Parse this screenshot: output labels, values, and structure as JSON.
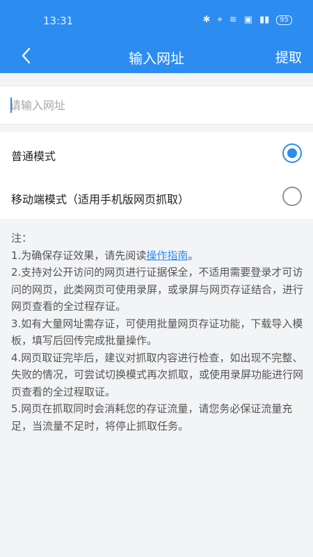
{
  "status_bar": {
    "time": "13:31",
    "icons": [
      "bluetooth-icon",
      "location-icon",
      "wifi-icon",
      "hd-icon",
      "signal-icon"
    ],
    "battery": "95"
  },
  "header": {
    "title": "输入网址",
    "action_label": "提取"
  },
  "url_input": {
    "placeholder": "请输入网址",
    "value": ""
  },
  "modes": [
    {
      "label": "普通模式",
      "selected": true
    },
    {
      "label": "移动端模式（适用手机版网页抓取）",
      "selected": false
    }
  ],
  "notes": {
    "heading": "注：",
    "item1_prefix": "1.为确保存证效果，请先阅读",
    "item1_link": "操作指南",
    "item1_suffix": "。",
    "item2": "2.支持对公开访问的网页进行证据保全，不适用需要登录才可访问的网页，此类网页可使用录屏，或录屏与网页存证结合，进行网页查看的全过程存证。",
    "item3": "3.如有大量网址需存证，可使用批量网页存证功能，下载导入模板，填写后回传完成批量操作。",
    "item4": "4.网页取证完毕后，建议对抓取内容进行检查，如出现不完整、失败的情况，可尝试切换模式再次抓取，或使用录屏功能进行网页查看的全过程取证。",
    "item5": "5.网页在抓取同时会消耗您的存证流量，请您务必保证流量充足，当流量不足时，将停止抓取任务。"
  },
  "colors": {
    "primary": "#2d8cf0",
    "background": "#f3f4f6"
  }
}
